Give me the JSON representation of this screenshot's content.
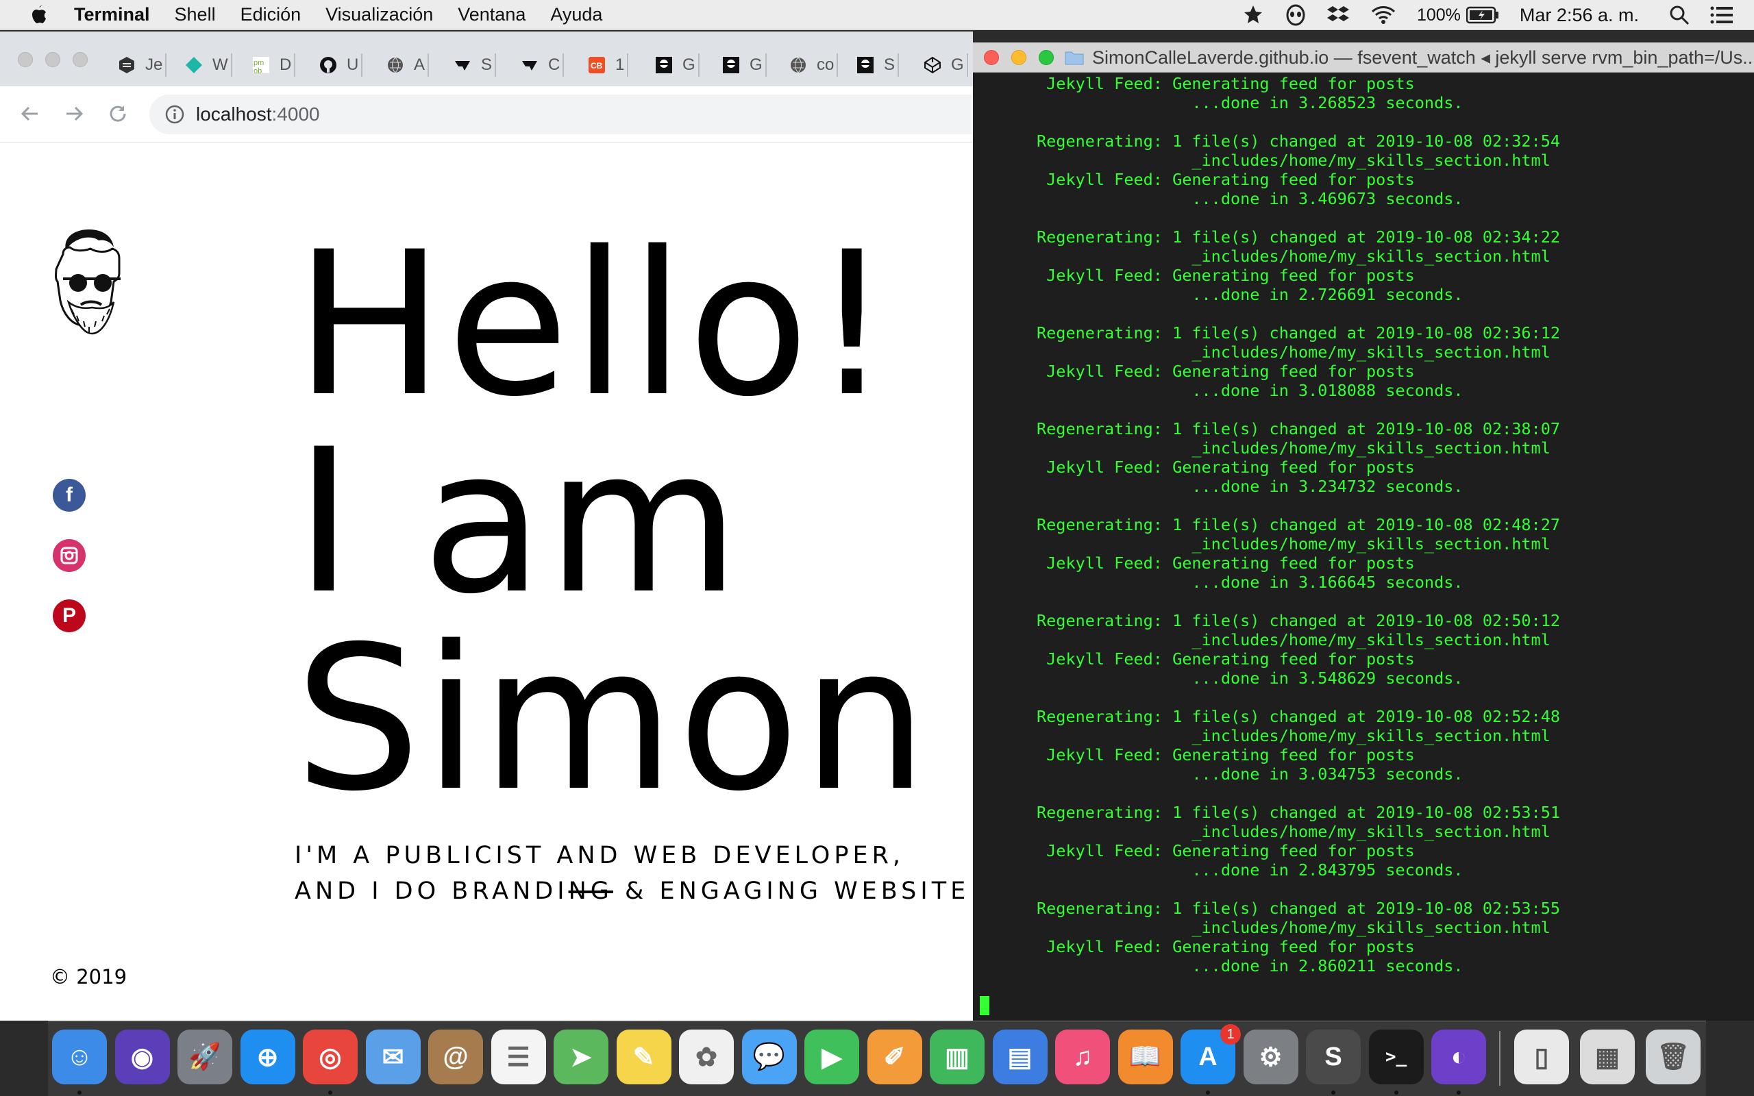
{
  "menubar": {
    "app_name": "Terminal",
    "items": [
      "Shell",
      "Edición",
      "Visualización",
      "Ventana",
      "Ayuda"
    ],
    "battery": "100%",
    "clock": "Mar 2:56 a. m."
  },
  "browser": {
    "tabs": [
      {
        "icon": "sketch-icon",
        "label": "Je"
      },
      {
        "icon": "teal-diamond-icon",
        "label": "W"
      },
      {
        "icon": "pmob-icon",
        "label": "D"
      },
      {
        "icon": "github-icon",
        "label": "U"
      },
      {
        "icon": "globe-icon",
        "label": "A"
      },
      {
        "icon": "ta-icon",
        "label": "S"
      },
      {
        "icon": "ta-icon",
        "label": "C"
      },
      {
        "icon": "cb-icon",
        "label": "1"
      },
      {
        "icon": "avatar-icon",
        "label": "G"
      },
      {
        "icon": "avatar-icon",
        "label": "G"
      },
      {
        "icon": "globe-icon",
        "label": "co"
      },
      {
        "icon": "avatar-icon",
        "label": "S"
      },
      {
        "icon": "codepen-icon",
        "label": "G"
      }
    ],
    "address": {
      "host": "localhost",
      "port": ":4000"
    }
  },
  "page": {
    "hero_lines": [
      "Hello!",
      "I am",
      "Simon"
    ],
    "subtitle_line1": "I'M A PUBLICIST AND WEB DEVELOPER,",
    "subtitle_line2_pre": "AND I DO BRANDI",
    "subtitle_line2_strike": "NG",
    "subtitle_line2_post": " & ENGAGING WEBSITE",
    "copyright": "© 2019",
    "social": [
      {
        "icon": "facebook-icon",
        "glyph": "f",
        "color": "#3b5998"
      },
      {
        "icon": "instagram-icon",
        "glyph": "",
        "color": "#d6336c"
      },
      {
        "icon": "pinterest-icon",
        "glyph": "P",
        "color": "#bd081c"
      }
    ]
  },
  "terminal": {
    "title": "SimonCalleLaverde.github.io — fsevent_watch ◂ jekyll serve rvm_bin_path=/Us...",
    "lines": [
      " Jekyll Feed: Generating feed for posts",
      "                ...done in 3.268523 seconds.",
      "",
      "Regenerating: 1 file(s) changed at 2019-10-08 02:32:54",
      "                _includes/home/my_skills_section.html",
      " Jekyll Feed: Generating feed for posts",
      "                ...done in 3.469673 seconds.",
      "",
      "Regenerating: 1 file(s) changed at 2019-10-08 02:34:22",
      "                _includes/home/my_skills_section.html",
      " Jekyll Feed: Generating feed for posts",
      "                ...done in 2.726691 seconds.",
      "",
      "Regenerating: 1 file(s) changed at 2019-10-08 02:36:12",
      "                _includes/home/my_skills_section.html",
      " Jekyll Feed: Generating feed for posts",
      "                ...done in 3.018088 seconds.",
      "",
      "Regenerating: 1 file(s) changed at 2019-10-08 02:38:07",
      "                _includes/home/my_skills_section.html",
      " Jekyll Feed: Generating feed for posts",
      "                ...done in 3.234732 seconds.",
      "",
      "Regenerating: 1 file(s) changed at 2019-10-08 02:48:27",
      "                _includes/home/my_skills_section.html",
      " Jekyll Feed: Generating feed for posts",
      "                ...done in 3.166645 seconds.",
      "",
      "Regenerating: 1 file(s) changed at 2019-10-08 02:50:12",
      "                _includes/home/my_skills_section.html",
      " Jekyll Feed: Generating feed for posts",
      "                ...done in 3.548629 seconds.",
      "",
      "Regenerating: 1 file(s) changed at 2019-10-08 02:52:48",
      "                _includes/home/my_skills_section.html",
      " Jekyll Feed: Generating feed for posts",
      "                ...done in 3.034753 seconds.",
      "",
      "Regenerating: 1 file(s) changed at 2019-10-08 02:53:51",
      "                _includes/home/my_skills_section.html",
      " Jekyll Feed: Generating feed for posts",
      "                ...done in 2.843795 seconds.",
      "",
      "Regenerating: 1 file(s) changed at 2019-10-08 02:53:55",
      "                _includes/home/my_skills_section.html",
      " Jekyll Feed: Generating feed for posts",
      "                ...done in 2.860211 seconds."
    ]
  },
  "dock": {
    "apps": [
      {
        "icon": "finder-icon",
        "glyph": "☺",
        "color": "#3d8be8",
        "running": true
      },
      {
        "icon": "siri-icon",
        "glyph": "◉",
        "color": "#5b3fb8",
        "running": false
      },
      {
        "icon": "launchpad-icon",
        "glyph": "🚀",
        "color": "#7a7f88",
        "running": false
      },
      {
        "icon": "safari-icon",
        "glyph": "⊕",
        "color": "#1f8ef1",
        "running": false
      },
      {
        "icon": "chrome-icon",
        "glyph": "◎",
        "color": "#e8453c",
        "running": true
      },
      {
        "icon": "mail-icon",
        "glyph": "✉",
        "color": "#5aa0e8",
        "running": false
      },
      {
        "icon": "contacts-icon",
        "glyph": "@",
        "color": "#a67c4e",
        "running": false
      },
      {
        "icon": "reminders-icon",
        "glyph": "☰",
        "color": "#f4f4f4",
        "running": false
      },
      {
        "icon": "maps-icon",
        "glyph": "➤",
        "color": "#5bb85d",
        "running": false
      },
      {
        "icon": "notes-icon",
        "glyph": "✎",
        "color": "#f7d54a",
        "running": false
      },
      {
        "icon": "photos-icon",
        "glyph": "✿",
        "color": "#f0f0f0",
        "running": false
      },
      {
        "icon": "messages-icon",
        "glyph": "💬",
        "color": "#4aa3f5",
        "running": false
      },
      {
        "icon": "facetime-icon",
        "glyph": "▶",
        "color": "#3fc05a",
        "running": false
      },
      {
        "icon": "pages-icon",
        "glyph": "✐",
        "color": "#f29b38",
        "running": false
      },
      {
        "icon": "numbers-icon",
        "glyph": "▥",
        "color": "#3fb85b",
        "running": false
      },
      {
        "icon": "keynote-icon",
        "glyph": "▤",
        "color": "#3b7de0",
        "running": false
      },
      {
        "icon": "itunes-icon",
        "glyph": "♫",
        "color": "#f0517a",
        "running": false
      },
      {
        "icon": "ibooks-icon",
        "glyph": "📖",
        "color": "#f28a2e",
        "running": false
      },
      {
        "icon": "app-store-icon",
        "glyph": "A",
        "color": "#1e8ef0",
        "running": true,
        "badge": "1"
      },
      {
        "icon": "system-preferences-icon",
        "glyph": "⚙",
        "color": "#7c7f84",
        "running": false
      },
      {
        "icon": "sublime-text-icon",
        "glyph": "S",
        "color": "#4a4a4a",
        "running": true
      },
      {
        "icon": "terminal-icon",
        "glyph": ">_",
        "color": "#1b1b1b",
        "running": true
      },
      {
        "icon": "github-desktop-icon",
        "glyph": "◐",
        "color": "#6e40c9",
        "running": true
      }
    ],
    "extras": [
      {
        "icon": "mouse-icon",
        "glyph": "▯",
        "color": "#e9e9e9"
      },
      {
        "icon": "downloads-icon",
        "glyph": "▦",
        "color": "#dcdcdc"
      },
      {
        "icon": "trash-icon",
        "glyph": "🗑",
        "color": "#cfd3d6"
      }
    ]
  }
}
